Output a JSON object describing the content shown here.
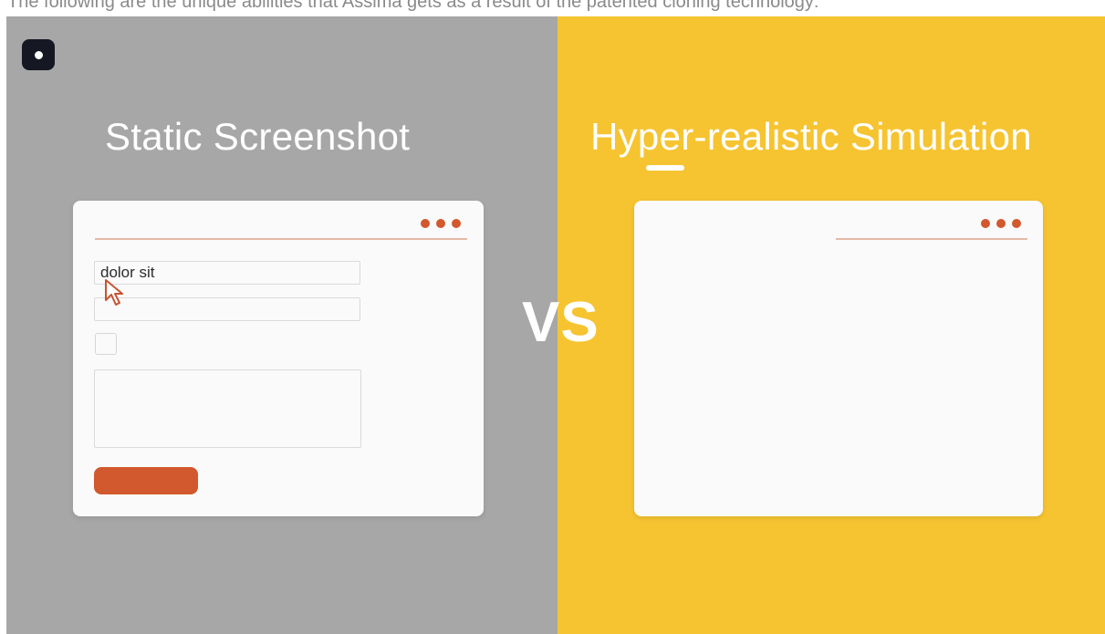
{
  "intro_text": "The following are the unique abilities that Assima gets as a result of the patented cloning technology:",
  "logo": {
    "icon": "app-logo-icon",
    "background": "#151823"
  },
  "left_panel": {
    "title": "Static Screenshot",
    "background": "#a7a7a7",
    "form": {
      "first_field_value": "dolor sit",
      "second_field_value": "",
      "textarea_value": "",
      "cursor_icon": "mouse-pointer-icon",
      "accent": "#d2582d"
    }
  },
  "comparison": {
    "label": "VS"
  },
  "right_panel": {
    "title": "Hyper-realistic Simulation",
    "background": "#f6c431"
  }
}
